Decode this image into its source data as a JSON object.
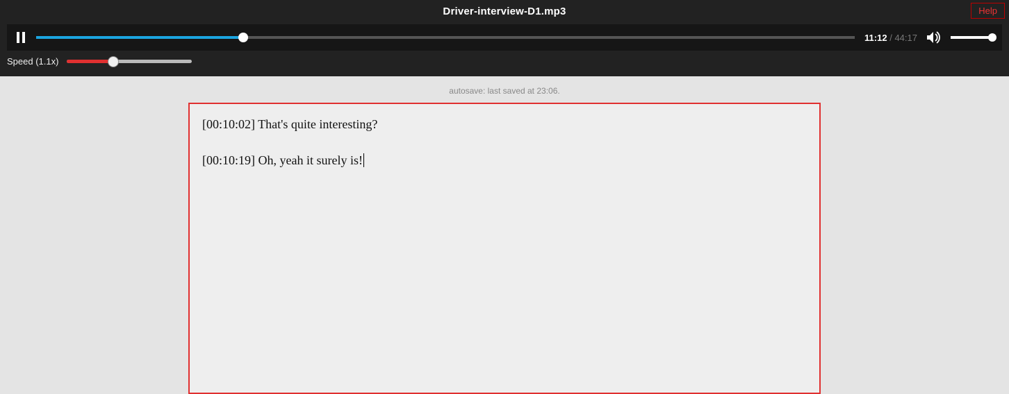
{
  "header": {
    "title": "Driver-interview-D1.mp3",
    "help_label": "Help"
  },
  "player": {
    "current_time": "11:12",
    "total_time": "44:17",
    "progress_percent": 25.3,
    "volume_percent": 100
  },
  "speed": {
    "label": "Speed (1.1x)",
    "fill_percent": 37
  },
  "autosave": {
    "text": "autosave: last saved at 23:06."
  },
  "transcript": {
    "lines": [
      "[00:10:02] That's quite interesting?",
      "",
      "[00:10:19] Oh, yeah it surely is!"
    ]
  }
}
